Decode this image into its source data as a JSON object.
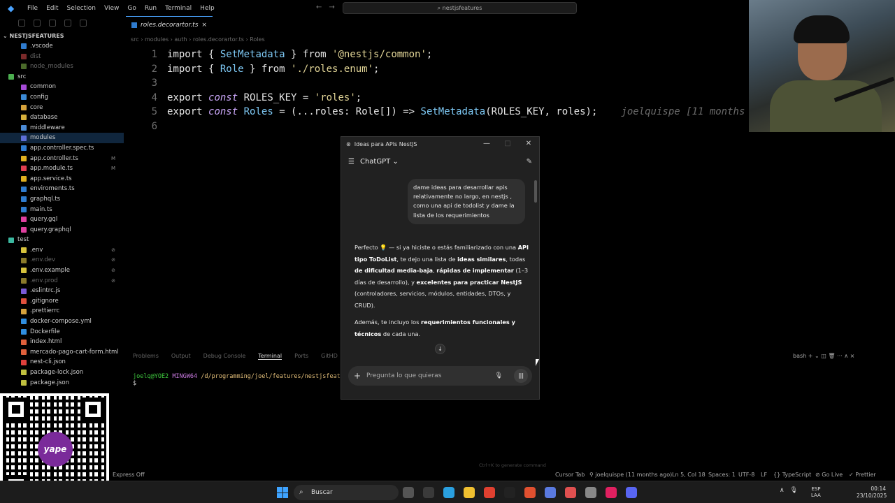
{
  "menu": [
    "File",
    "Edit",
    "Selection",
    "View",
    "Go",
    "Run",
    "Terminal",
    "Help"
  ],
  "search_title": "nestjsfeatures",
  "explorer": {
    "root": "NESTJSFEATURES",
    "items": [
      {
        "label": ".vscode",
        "color": "#2f7ccf",
        "indent": 1,
        "dim": false,
        "badge": ""
      },
      {
        "label": "dist",
        "color": "#7a2a2a",
        "indent": 1,
        "dim": true,
        "badge": ""
      },
      {
        "label": "node_modules",
        "color": "#4a6a2a",
        "indent": 1,
        "dim": true,
        "badge": ""
      },
      {
        "label": "src",
        "color": "#4caf50",
        "indent": 0,
        "dim": false,
        "badge": ""
      },
      {
        "label": "common",
        "color": "#a64bd6",
        "indent": 1,
        "dim": false,
        "badge": ""
      },
      {
        "label": "config",
        "color": "#3c8ad6",
        "indent": 1,
        "dim": false,
        "badge": ""
      },
      {
        "label": "core",
        "color": "#d6a23c",
        "indent": 1,
        "dim": false,
        "badge": ""
      },
      {
        "label": "database",
        "color": "#d6b03c",
        "indent": 1,
        "dim": false,
        "badge": ""
      },
      {
        "label": "middleware",
        "color": "#4c8bd6",
        "indent": 1,
        "dim": false,
        "badge": ""
      },
      {
        "label": "modules",
        "color": "#5d6fd6",
        "indent": 1,
        "dim": false,
        "badge": "",
        "sel": true
      },
      {
        "label": "app.controller.spec.ts",
        "color": "#2f7ccf",
        "indent": 1,
        "dim": false,
        "badge": ""
      },
      {
        "label": "app.controller.ts",
        "color": "#e0b020",
        "indent": 1,
        "dim": false,
        "badge": "M"
      },
      {
        "label": "app.module.ts",
        "color": "#e04050",
        "indent": 1,
        "dim": false,
        "badge": "M"
      },
      {
        "label": "app.service.ts",
        "color": "#e0b020",
        "indent": 1,
        "dim": false,
        "badge": ""
      },
      {
        "label": "enviroments.ts",
        "color": "#2f7ccf",
        "indent": 1,
        "dim": false,
        "badge": ""
      },
      {
        "label": "graphql.ts",
        "color": "#2f7ccf",
        "indent": 1,
        "dim": false,
        "badge": ""
      },
      {
        "label": "main.ts",
        "color": "#2f7ccf",
        "indent": 1,
        "dim": false,
        "badge": ""
      },
      {
        "label": "query.gql",
        "color": "#e040a0",
        "indent": 1,
        "dim": false,
        "badge": ""
      },
      {
        "label": "query.graphql",
        "color": "#e040a0",
        "indent": 1,
        "dim": false,
        "badge": ""
      },
      {
        "label": "test",
        "color": "#3cb8a0",
        "indent": 0,
        "dim": false,
        "badge": ""
      },
      {
        "label": ".env",
        "color": "#d6c23c",
        "indent": 1,
        "dim": false,
        "badge": "⊘"
      },
      {
        "label": ".env.dev",
        "color": "#8a7a2a",
        "indent": 1,
        "dim": true,
        "badge": "⊘"
      },
      {
        "label": ".env.example",
        "color": "#d6c23c",
        "indent": 1,
        "dim": false,
        "badge": "⊘"
      },
      {
        "label": ".env.prod",
        "color": "#8a7a2a",
        "indent": 1,
        "dim": true,
        "badge": "⊘"
      },
      {
        "label": ".eslintrc.js",
        "color": "#7a5ad6",
        "indent": 1,
        "dim": false,
        "badge": ""
      },
      {
        "label": ".gitignore",
        "color": "#e0503c",
        "indent": 1,
        "dim": false,
        "badge": ""
      },
      {
        "label": ".prettierrc",
        "color": "#d6a23c",
        "indent": 1,
        "dim": false,
        "badge": ""
      },
      {
        "label": "docker-compose.yml",
        "color": "#2f8ee0",
        "indent": 1,
        "dim": false,
        "badge": ""
      },
      {
        "label": "Dockerfile",
        "color": "#2f8ee0",
        "indent": 1,
        "dim": false,
        "badge": ""
      },
      {
        "label": "index.html",
        "color": "#e0603c",
        "indent": 1,
        "dim": false,
        "badge": ""
      },
      {
        "label": "mercado-pago-cart-form.html",
        "color": "#e0603c",
        "indent": 1,
        "dim": false,
        "badge": ""
      },
      {
        "label": "nest-cli.json",
        "color": "#e0403c",
        "indent": 1,
        "dim": false,
        "badge": ""
      },
      {
        "label": "package-lock.json",
        "color": "#c0c040",
        "indent": 1,
        "dim": false,
        "badge": ""
      },
      {
        "label": "package.json",
        "color": "#c0c040",
        "indent": 1,
        "dim": false,
        "badge": ""
      }
    ]
  },
  "tab": {
    "label": "roles.decorartor.ts",
    "close": "×"
  },
  "breadcrumbs": "src  ›  modules  ›  auth  ›  roles.decorartor.ts  ›  Roles",
  "code": {
    "l1": {
      "n": "1",
      "a": "import",
      "b": " { ",
      "c": "SetMetadata",
      "d": " } ",
      "e": "from",
      "f": " '@nestjs/common'",
      ";": ";"
    },
    "l2": {
      "n": "2",
      "a": "import",
      "b": " { ",
      "c": "Role",
      "d": " } ",
      "e": "from",
      "f": " './roles.enum'",
      ";": ";"
    },
    "l3": {
      "n": "3"
    },
    "l4": {
      "n": "4",
      "a": "export",
      "b": "const",
      "c": "ROLES_KEY",
      "d": " = ",
      "f": "'roles'",
      ";": ";"
    },
    "l5": {
      "n": "5",
      "a": "export",
      "b": "const",
      "c": "Roles",
      "d": " = (...",
      "e": "roles",
      "g": ": Role[]) => ",
      "h": "SetMetadata",
      "i": "(ROLES_KEY, roles);",
      "blame": "joelquispe [11 months"
    },
    "l6": {
      "n": "6"
    }
  },
  "panel": {
    "tabs": [
      "Problems",
      "Output",
      "Debug Console",
      "Terminal",
      "Ports",
      "GitHD"
    ],
    "right": "bash  +  ⌄  ◫  🗑  ···  ∧  ×"
  },
  "terminal": {
    "user": "joelq@YOE2",
    "env": "MINGW64",
    "path": "/d/programming/joel/features/nestjsfeatures",
    "prompt": "$"
  },
  "hint": "Ctrl+K to generate command",
  "status": {
    "left": "Express Off",
    "cursor_tab": "Cursor Tab",
    "blame": "⚲ joelquispe (11 months ago)",
    "position": "Ln 5, Col 18",
    "spaces": "Spaces: 1",
    "encoding": "UTF-8",
    "eol": "LF",
    "lang": "{} TypeScript",
    "golive": "⊘ Go Live",
    "prettier": "✓ Prettier"
  },
  "qr": {
    "brand": "yape"
  },
  "chat": {
    "window_title": "Ideas para APIs NestJS",
    "controls": [
      "—",
      "□",
      "✕"
    ],
    "model": "ChatGPT",
    "user_msg": "dame ideas para desarrollar apis relativamente no largo, en nestjs , como una api de todolist y dame la lista de los requerimientos",
    "reply": {
      "p1_a": "Perfecto 💡 — si ya hiciste o estás familiarizado con una ",
      "p1_b": "API tipo ToDoList",
      "p1_c": ", te dejo una lista de ",
      "p1_d": "ideas similares",
      "p1_e": ", todas ",
      "p1_f": "de dificultad media-baja",
      "p1_g": ", ",
      "p1_h": "rápidas de implementar",
      "p1_i": " (1–3 días de desarrollo), y ",
      "p1_j": "excelentes para practicar NestJS",
      "p1_k": " (controladores, servicios, módulos, entidades, DTOs, y CRUD).",
      "p2_a": "Además, te incluyo los ",
      "p2_b": "requerimientos funcionales y técnicos",
      "p2_c": " de cada una."
    },
    "placeholder": "Pregunta lo que quieras"
  },
  "taskbar": {
    "search": "Buscar",
    "lang_top": "ESP",
    "lang_bottom": "LAA",
    "time": "00:14",
    "date": "23/10/2025",
    "app_colors": [
      "#555",
      "#3a3a3a",
      "#2aa0e0",
      "#f0c030",
      "#e04030",
      "#222",
      "#e05030",
      "#5a7ae0",
      "#e05050",
      "#888",
      "#e02060",
      "#5865f2"
    ]
  }
}
